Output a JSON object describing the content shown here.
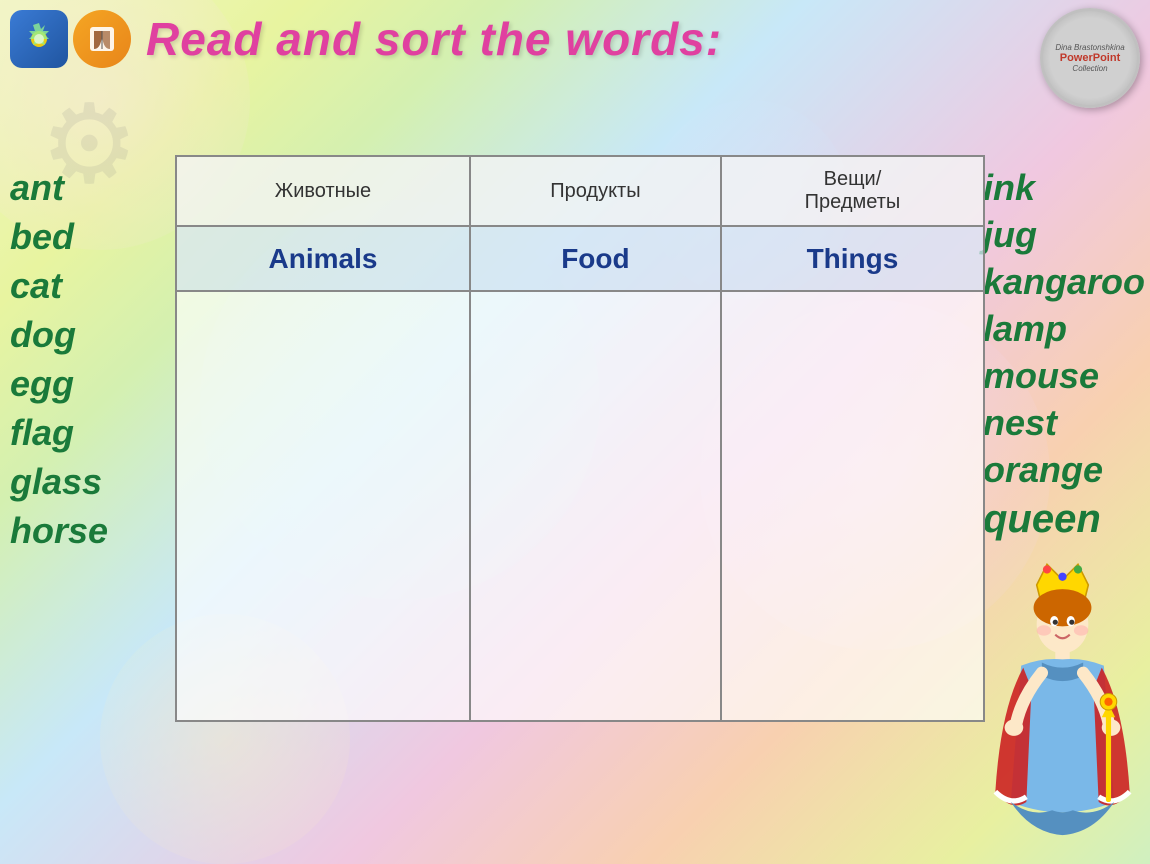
{
  "header": {
    "title": "Read and sort the words:",
    "powerpoint": {
      "author_top": "Dina Brastonshkina",
      "main": "PowerPoint",
      "sub": "Collection"
    }
  },
  "left_words": [
    "ant",
    "bed",
    "cat",
    "dog",
    "egg",
    "flag",
    "glass",
    "horse"
  ],
  "right_words": [
    "ink",
    "jug",
    "kangaroo",
    "lamp",
    "mouse",
    "nest",
    "orange",
    "queen"
  ],
  "table": {
    "header_ru": [
      "Животные",
      "Продукты",
      "Вещи/\nПредметы"
    ],
    "header_en": [
      "Animals",
      "Food",
      "Things"
    ]
  }
}
